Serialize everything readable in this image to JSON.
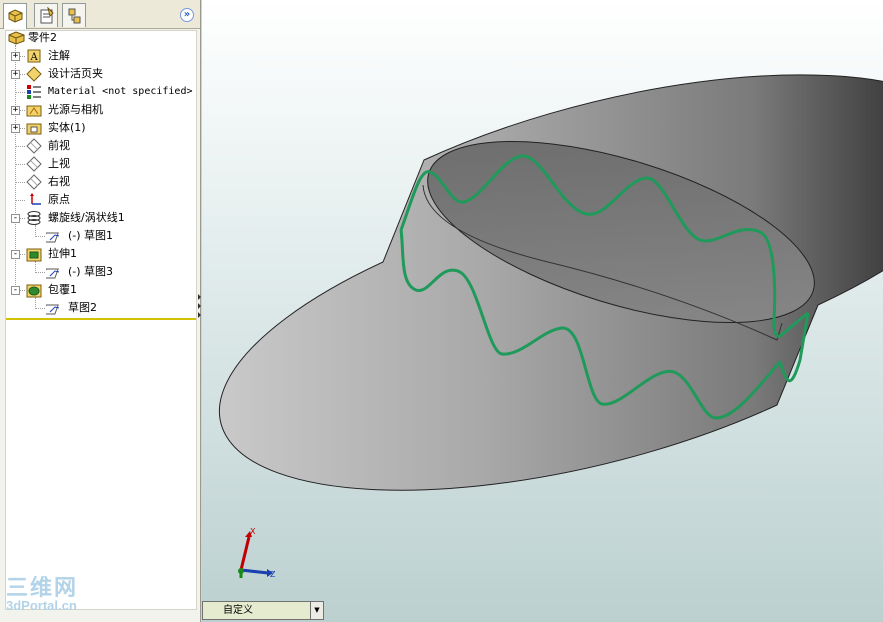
{
  "tree": {
    "root": "零件2",
    "items": [
      {
        "label": "注解",
        "icon": "annotations-icon",
        "level": 1,
        "expander": "+"
      },
      {
        "label": "设计活页夹",
        "icon": "design-binder-icon",
        "level": 1,
        "expander": "+"
      },
      {
        "label": "Material <not specified>",
        "icon": "material-icon",
        "level": 1,
        "expander": ""
      },
      {
        "label": "光源与相机",
        "icon": "lights-cameras-icon",
        "level": 1,
        "expander": "+"
      },
      {
        "label": "实体(1)",
        "icon": "solid-bodies-icon",
        "level": 1,
        "expander": "+"
      },
      {
        "label": "前视",
        "icon": "plane-icon",
        "level": 1,
        "expander": ""
      },
      {
        "label": "上视",
        "icon": "plane-icon",
        "level": 1,
        "expander": ""
      },
      {
        "label": "右视",
        "icon": "plane-icon",
        "level": 1,
        "expander": ""
      },
      {
        "label": "原点",
        "icon": "origin-icon",
        "level": 1,
        "expander": ""
      },
      {
        "label": "螺旋线/涡状线1",
        "icon": "helix-icon",
        "level": 1,
        "expander": "-"
      },
      {
        "label": "(-) 草图1",
        "icon": "sketch-icon",
        "level": 2,
        "expander": ""
      },
      {
        "label": "拉伸1",
        "icon": "extrude-icon",
        "level": 1,
        "expander": "-"
      },
      {
        "label": "(-) 草图3",
        "icon": "sketch-icon",
        "level": 2,
        "expander": ""
      },
      {
        "label": "包覆1",
        "icon": "wrap-icon",
        "level": 1,
        "expander": "-"
      },
      {
        "label": "草图2",
        "icon": "sketch-icon",
        "level": 2,
        "expander": ""
      }
    ]
  },
  "tabs": [
    "feature-manager-tab",
    "property-manager-tab",
    "configuration-manager-tab"
  ],
  "view_orientation": {
    "value": "自定义"
  },
  "triad": {
    "x": "X",
    "z": "Z"
  },
  "watermark": {
    "cn": "三维网",
    "en": "3dPortal.cn"
  },
  "colors": {
    "curve": "#1f9a5a",
    "accent": "#215dc6",
    "rollback": "#d4c200"
  }
}
